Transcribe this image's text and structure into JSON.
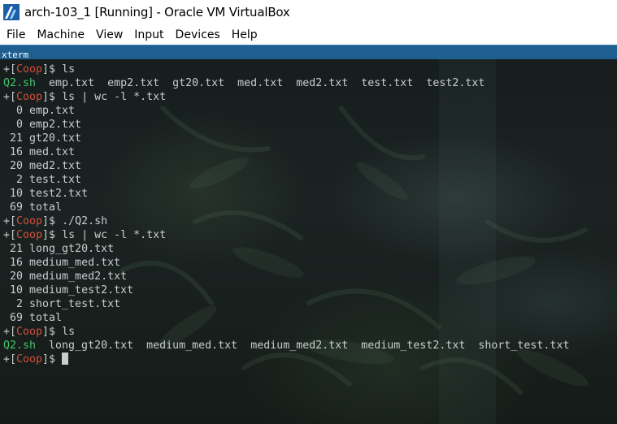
{
  "window": {
    "title": "arch-103_1 [Running] - Oracle VM VirtualBox",
    "icon": "virtualbox-icon"
  },
  "menu": {
    "items": [
      "File",
      "Machine",
      "View",
      "Input",
      "Devices",
      "Help"
    ]
  },
  "xterm": {
    "label": "xterm"
  },
  "terminal": {
    "prompt": {
      "open": "+[",
      "user": "Coop",
      "close": "]$"
    },
    "colors": {
      "prompt_user": "#d0503c",
      "executable": "#46c46c",
      "text": "#c8cdcd",
      "label_bar": "#1f5f8f"
    },
    "lines": [
      {
        "type": "cmd",
        "cmd": " ls"
      },
      {
        "type": "ls",
        "exec": "Q2.sh",
        "files": [
          "emp.txt",
          "emp2.txt",
          "gt20.txt",
          "med.txt",
          "med2.txt",
          "test.txt",
          "test2.txt"
        ]
      },
      {
        "type": "cmd",
        "cmd": " ls | wc -l *.txt"
      },
      {
        "type": "out",
        "text": "  0 emp.txt"
      },
      {
        "type": "out",
        "text": "  0 emp2.txt"
      },
      {
        "type": "out",
        "text": " 21 gt20.txt"
      },
      {
        "type": "out",
        "text": " 16 med.txt"
      },
      {
        "type": "out",
        "text": " 20 med2.txt"
      },
      {
        "type": "out",
        "text": "  2 test.txt"
      },
      {
        "type": "out",
        "text": " 10 test2.txt"
      },
      {
        "type": "out",
        "text": " 69 total"
      },
      {
        "type": "cmd",
        "cmd": " ./Q2.sh"
      },
      {
        "type": "cmd",
        "cmd": " ls | wc -l *.txt"
      },
      {
        "type": "out",
        "text": " 21 long_gt20.txt"
      },
      {
        "type": "out",
        "text": " 16 medium_med.txt"
      },
      {
        "type": "out",
        "text": " 20 medium_med2.txt"
      },
      {
        "type": "out",
        "text": " 10 medium_test2.txt"
      },
      {
        "type": "out",
        "text": "  2 short_test.txt"
      },
      {
        "type": "out",
        "text": " 69 total"
      },
      {
        "type": "cmd",
        "cmd": " ls"
      },
      {
        "type": "ls",
        "exec": "Q2.sh",
        "files": [
          "long_gt20.txt",
          "medium_med.txt",
          "medium_med2.txt",
          "medium_test2.txt",
          "short_test.txt"
        ]
      },
      {
        "type": "cursor",
        "cmd": ""
      }
    ]
  }
}
